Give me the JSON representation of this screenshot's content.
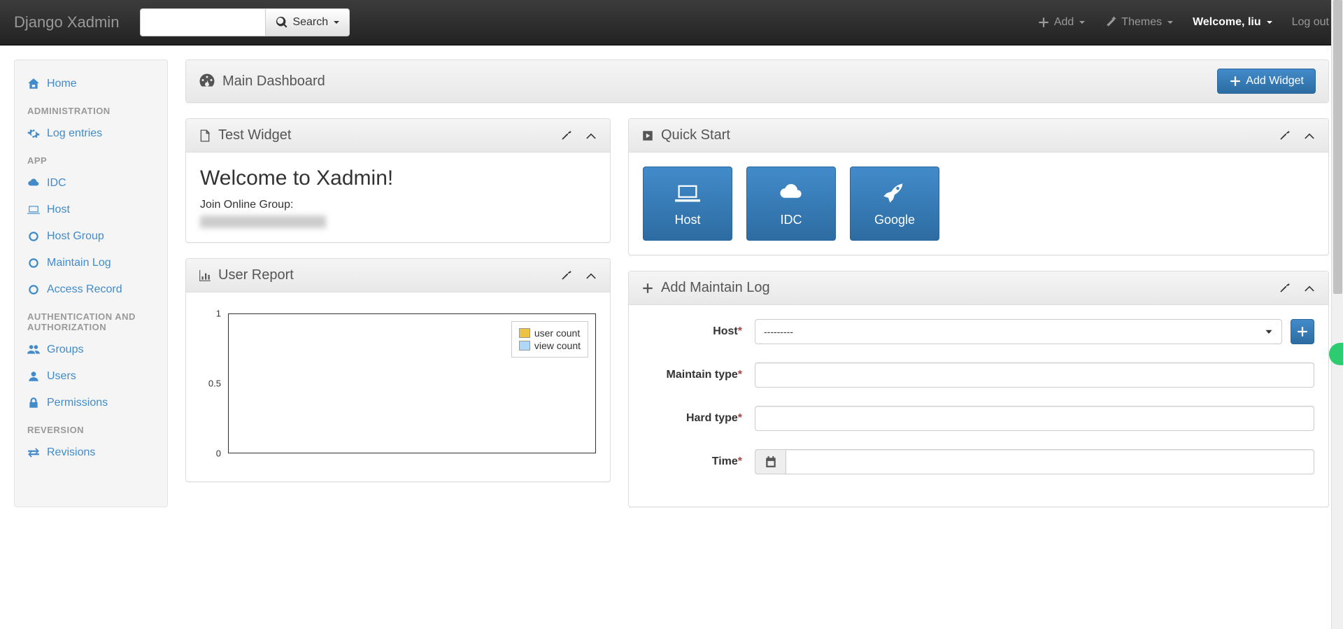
{
  "navbar": {
    "brand": "Django Xadmin",
    "search_button": "Search",
    "add_label": "Add",
    "themes_label": "Themes",
    "welcome_label": "Welcome, liu",
    "logout_label": "Log out"
  },
  "sidebar": {
    "home": "Home",
    "sections": {
      "administration": "ADMINISTRATION",
      "app": "APP",
      "auth": "AUTHENTICATION AND AUTHORIZATION",
      "reversion": "REVERSION"
    },
    "items": {
      "log_entries": "Log entries",
      "idc": "IDC",
      "host": "Host",
      "host_group": "Host Group",
      "maintain_log": "Maintain Log",
      "access_record": "Access Record",
      "groups": "Groups",
      "users": "Users",
      "permissions": "Permissions",
      "revisions": "Revisions"
    }
  },
  "dashboard": {
    "title": "Main Dashboard",
    "add_widget": "Add Widget"
  },
  "test_widget": {
    "title": "Test Widget",
    "heading": "Welcome to Xadmin!",
    "subtext": "Join Online Group:"
  },
  "user_report": {
    "title": "User Report",
    "legend": {
      "user_count": "user count",
      "view_count": "view count"
    }
  },
  "quick_start": {
    "title": "Quick Start",
    "buttons": {
      "host": "Host",
      "idc": "IDC",
      "google": "Google"
    }
  },
  "add_maintain": {
    "title": "Add Maintain Log",
    "fields": {
      "host": "Host",
      "maintain_type": "Maintain type",
      "hard_type": "Hard type",
      "time": "Time"
    },
    "host_placeholder": "---------"
  },
  "chart_data": {
    "type": "line",
    "title": "User Report",
    "ylim": [
      0,
      1.0
    ],
    "yticks": [
      0.0,
      0.5,
      1.0
    ],
    "series": [
      {
        "name": "user count",
        "values": []
      },
      {
        "name": "view count",
        "values": []
      }
    ]
  }
}
